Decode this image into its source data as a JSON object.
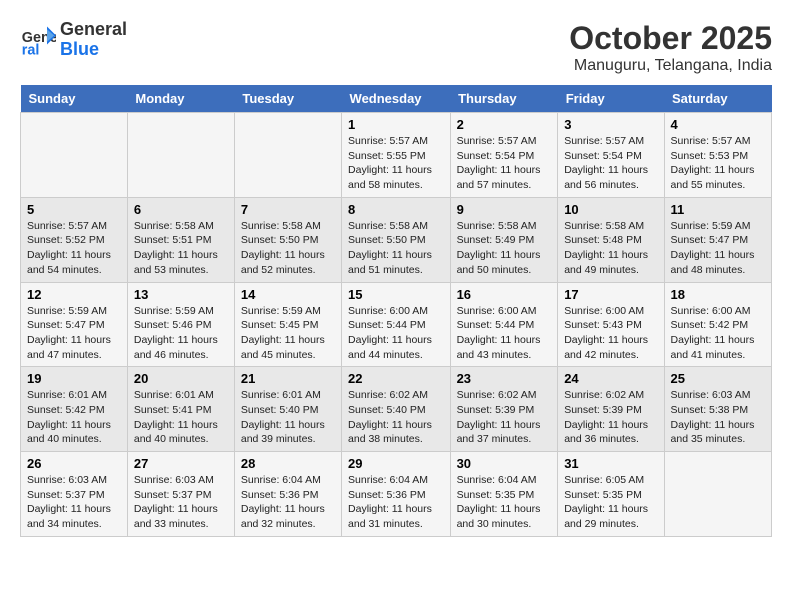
{
  "header": {
    "logo_line1": "General",
    "logo_line2": "Blue",
    "month": "October 2025",
    "location": "Manuguru, Telangana, India"
  },
  "weekdays": [
    "Sunday",
    "Monday",
    "Tuesday",
    "Wednesday",
    "Thursday",
    "Friday",
    "Saturday"
  ],
  "weeks": [
    [
      {
        "day": "",
        "info": ""
      },
      {
        "day": "",
        "info": ""
      },
      {
        "day": "",
        "info": ""
      },
      {
        "day": "1",
        "info": "Sunrise: 5:57 AM\nSunset: 5:55 PM\nDaylight: 11 hours\nand 58 minutes."
      },
      {
        "day": "2",
        "info": "Sunrise: 5:57 AM\nSunset: 5:54 PM\nDaylight: 11 hours\nand 57 minutes."
      },
      {
        "day": "3",
        "info": "Sunrise: 5:57 AM\nSunset: 5:54 PM\nDaylight: 11 hours\nand 56 minutes."
      },
      {
        "day": "4",
        "info": "Sunrise: 5:57 AM\nSunset: 5:53 PM\nDaylight: 11 hours\nand 55 minutes."
      }
    ],
    [
      {
        "day": "5",
        "info": "Sunrise: 5:57 AM\nSunset: 5:52 PM\nDaylight: 11 hours\nand 54 minutes."
      },
      {
        "day": "6",
        "info": "Sunrise: 5:58 AM\nSunset: 5:51 PM\nDaylight: 11 hours\nand 53 minutes."
      },
      {
        "day": "7",
        "info": "Sunrise: 5:58 AM\nSunset: 5:50 PM\nDaylight: 11 hours\nand 52 minutes."
      },
      {
        "day": "8",
        "info": "Sunrise: 5:58 AM\nSunset: 5:50 PM\nDaylight: 11 hours\nand 51 minutes."
      },
      {
        "day": "9",
        "info": "Sunrise: 5:58 AM\nSunset: 5:49 PM\nDaylight: 11 hours\nand 50 minutes."
      },
      {
        "day": "10",
        "info": "Sunrise: 5:58 AM\nSunset: 5:48 PM\nDaylight: 11 hours\nand 49 minutes."
      },
      {
        "day": "11",
        "info": "Sunrise: 5:59 AM\nSunset: 5:47 PM\nDaylight: 11 hours\nand 48 minutes."
      }
    ],
    [
      {
        "day": "12",
        "info": "Sunrise: 5:59 AM\nSunset: 5:47 PM\nDaylight: 11 hours\nand 47 minutes."
      },
      {
        "day": "13",
        "info": "Sunrise: 5:59 AM\nSunset: 5:46 PM\nDaylight: 11 hours\nand 46 minutes."
      },
      {
        "day": "14",
        "info": "Sunrise: 5:59 AM\nSunset: 5:45 PM\nDaylight: 11 hours\nand 45 minutes."
      },
      {
        "day": "15",
        "info": "Sunrise: 6:00 AM\nSunset: 5:44 PM\nDaylight: 11 hours\nand 44 minutes."
      },
      {
        "day": "16",
        "info": "Sunrise: 6:00 AM\nSunset: 5:44 PM\nDaylight: 11 hours\nand 43 minutes."
      },
      {
        "day": "17",
        "info": "Sunrise: 6:00 AM\nSunset: 5:43 PM\nDaylight: 11 hours\nand 42 minutes."
      },
      {
        "day": "18",
        "info": "Sunrise: 6:00 AM\nSunset: 5:42 PM\nDaylight: 11 hours\nand 41 minutes."
      }
    ],
    [
      {
        "day": "19",
        "info": "Sunrise: 6:01 AM\nSunset: 5:42 PM\nDaylight: 11 hours\nand 40 minutes."
      },
      {
        "day": "20",
        "info": "Sunrise: 6:01 AM\nSunset: 5:41 PM\nDaylight: 11 hours\nand 40 minutes."
      },
      {
        "day": "21",
        "info": "Sunrise: 6:01 AM\nSunset: 5:40 PM\nDaylight: 11 hours\nand 39 minutes."
      },
      {
        "day": "22",
        "info": "Sunrise: 6:02 AM\nSunset: 5:40 PM\nDaylight: 11 hours\nand 38 minutes."
      },
      {
        "day": "23",
        "info": "Sunrise: 6:02 AM\nSunset: 5:39 PM\nDaylight: 11 hours\nand 37 minutes."
      },
      {
        "day": "24",
        "info": "Sunrise: 6:02 AM\nSunset: 5:39 PM\nDaylight: 11 hours\nand 36 minutes."
      },
      {
        "day": "25",
        "info": "Sunrise: 6:03 AM\nSunset: 5:38 PM\nDaylight: 11 hours\nand 35 minutes."
      }
    ],
    [
      {
        "day": "26",
        "info": "Sunrise: 6:03 AM\nSunset: 5:37 PM\nDaylight: 11 hours\nand 34 minutes."
      },
      {
        "day": "27",
        "info": "Sunrise: 6:03 AM\nSunset: 5:37 PM\nDaylight: 11 hours\nand 33 minutes."
      },
      {
        "day": "28",
        "info": "Sunrise: 6:04 AM\nSunset: 5:36 PM\nDaylight: 11 hours\nand 32 minutes."
      },
      {
        "day": "29",
        "info": "Sunrise: 6:04 AM\nSunset: 5:36 PM\nDaylight: 11 hours\nand 31 minutes."
      },
      {
        "day": "30",
        "info": "Sunrise: 6:04 AM\nSunset: 5:35 PM\nDaylight: 11 hours\nand 30 minutes."
      },
      {
        "day": "31",
        "info": "Sunrise: 6:05 AM\nSunset: 5:35 PM\nDaylight: 11 hours\nand 29 minutes."
      },
      {
        "day": "",
        "info": ""
      }
    ]
  ]
}
